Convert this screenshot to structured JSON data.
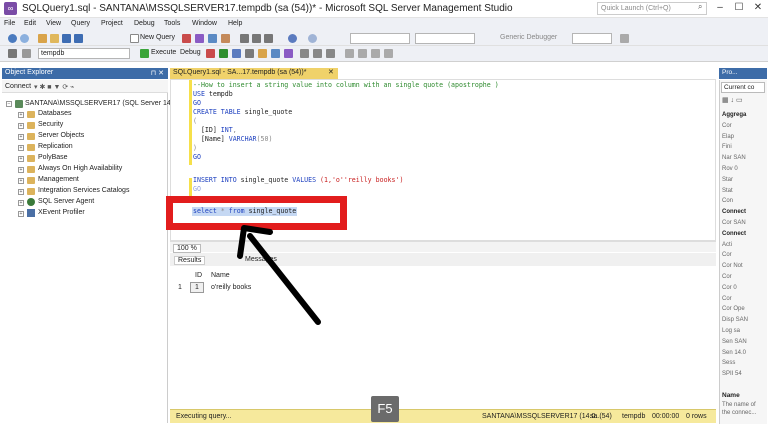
{
  "window": {
    "title": "SQLQuery1.sql - SANTANA\\MSSQLSERVER17.tempdb (sa (54))* - Microsoft SQL Server Management Studio",
    "quick_launch_placeholder": "Quick Launch (Ctrl+Q)"
  },
  "menu": [
    "File",
    "Edit",
    "View",
    "Query",
    "Project",
    "Debug",
    "Tools",
    "Window",
    "Help"
  ],
  "toolbar": {
    "new_query": "New Query",
    "database": "tempdb",
    "execute": "Execute",
    "debug": "Debug",
    "generic_debugger": "Generic Debugger"
  },
  "object_explorer": {
    "title": "Object Explorer",
    "connect": "Connect",
    "server": "SANTANA\\MSSQLSERVER17 (SQL Server 14.0.1",
    "items": [
      "Databases",
      "Security",
      "Server Objects",
      "Replication",
      "PolyBase",
      "Always On High Availability",
      "Management",
      "Integration Services Catalogs",
      "SQL Server Agent",
      "XEvent Profiler"
    ]
  },
  "document_tab": {
    "title": "SQLQuery1.sql - SA...17.tempdb (sa (54))*",
    "close": "✕"
  },
  "code": {
    "line1": "--How to insert a string value into column with an single quote (apostrophe )",
    "line2_kw": "USE",
    "line2_rest": " tempdb",
    "go": "GO",
    "create_kw": "CREATE TABLE",
    "create_rest": " single_quote",
    "open": "(",
    "id_col": "  [ID] ",
    "id_type": "INT",
    "id_comma": ",",
    "name_col": "  [Name] ",
    "name_type": "VARCHAR",
    "name_size": "(50)",
    "close": ")",
    "insert_kw": "INSERT INTO",
    "insert_tbl": " single_quote ",
    "values_kw": "VALUES",
    "insert_vals": " (1,'o''reilly books')",
    "select_kw": "select",
    "select_star": " * ",
    "from_kw": "from",
    "select_tbl": " single_quote"
  },
  "zoom": "100 %",
  "results": {
    "tab_results": "Results",
    "tab_messages": "Messages",
    "columns": [
      "ID",
      "Name"
    ],
    "rows": [
      {
        "num": "1",
        "id": "1",
        "name": "o'reilly books"
      }
    ]
  },
  "status": {
    "executing": "Executing query...",
    "server": "SANTANA\\MSSQLSERVER17 (14.0...",
    "user": "sa (54)",
    "db": "tempdb",
    "time": "00:00:00",
    "rows": "0 rows"
  },
  "overlay": {
    "key": "F5"
  },
  "properties": {
    "title": "Pro...",
    "current": "Current co",
    "rows": [
      {
        "t": "Aggrega",
        "bold": true
      },
      {
        "t": "Cor",
        "bold": false
      },
      {
        "t": "Elap",
        "bold": false
      },
      {
        "t": "Fini",
        "bold": false
      },
      {
        "t": "Nar SAN",
        "bold": false
      },
      {
        "t": "Rov 0",
        "bold": false
      },
      {
        "t": "Star",
        "bold": false
      },
      {
        "t": "Stat",
        "bold": false
      },
      {
        "t": "Con",
        "bold": false
      },
      {
        "t": "Connect",
        "bold": true
      },
      {
        "t": "Cor SAN",
        "bold": false
      },
      {
        "t": "Connect",
        "bold": true
      },
      {
        "t": "Acti",
        "bold": false
      },
      {
        "t": "Cor",
        "bold": false
      },
      {
        "t": "Cor Not",
        "bold": false
      },
      {
        "t": "Cor",
        "bold": false
      },
      {
        "t": "Cor 0",
        "bold": false
      },
      {
        "t": "Cor",
        "bold": false
      },
      {
        "t": "Cor Ope",
        "bold": false
      },
      {
        "t": "Disp SAN",
        "bold": false
      },
      {
        "t": "Log sa",
        "bold": false
      },
      {
        "t": "Sen SAN",
        "bold": false
      },
      {
        "t": "Sen 14.0",
        "bold": false
      },
      {
        "t": "Sess",
        "bold": false
      },
      {
        "t": "SPII 54",
        "bold": false
      }
    ],
    "name_label": "Name",
    "name_desc1": "The name of",
    "name_desc2": "the connec..."
  }
}
